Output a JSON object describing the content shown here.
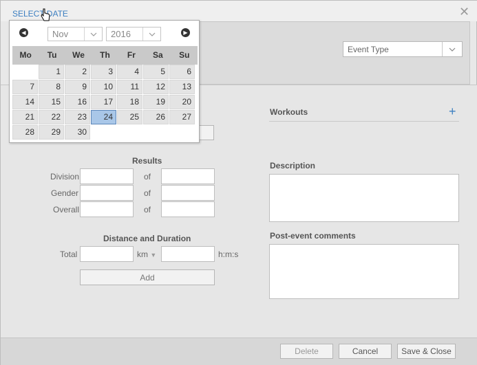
{
  "header": {
    "select_date_label": "SELECT DATE",
    "event_type_value": "Event Type"
  },
  "calendar": {
    "month": "Nov",
    "year": "2016",
    "weekdays": [
      "Mo",
      "Tu",
      "We",
      "Th",
      "Fr",
      "Sa",
      "Su"
    ],
    "weeks": [
      [
        "",
        "1",
        "2",
        "3",
        "4",
        "5",
        "6"
      ],
      [
        "7",
        "8",
        "9",
        "10",
        "11",
        "12",
        "13"
      ],
      [
        "14",
        "15",
        "16",
        "17",
        "18",
        "19",
        "20"
      ],
      [
        "21",
        "22",
        "23",
        "24",
        "25",
        "26",
        "27"
      ],
      [
        "28",
        "29",
        "30",
        "",
        "",
        "",
        ""
      ]
    ],
    "selected_day": "24"
  },
  "results": {
    "title": "Results",
    "rows": [
      {
        "label": "Division",
        "of": "of"
      },
      {
        "label": "Gender",
        "of": "of"
      },
      {
        "label": "Overall",
        "of": "of"
      }
    ]
  },
  "distance": {
    "title": "Distance and Duration",
    "total_label": "Total",
    "unit": "km",
    "time_unit": "h:m:s",
    "add_label": "Add"
  },
  "right": {
    "workouts_label": "Workouts",
    "description_label": "Description",
    "comments_label": "Post-event comments"
  },
  "footer": {
    "delete_label": "Delete",
    "cancel_label": "Cancel",
    "save_label": "Save & Close"
  }
}
